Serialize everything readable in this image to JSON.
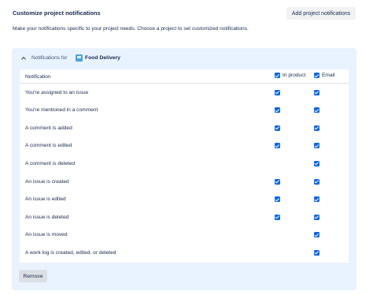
{
  "header": {
    "title": "Customize project notifications",
    "add_button_label": "Add project notifications",
    "description": "Make your notifications specific to your project needs. Choose a project to set customized notifications."
  },
  "panel": {
    "notifications_for_label": "Notifications for",
    "project_name": "Food Delivery",
    "project_icon": "project-board-icon",
    "expanded": true,
    "remove_button_label": "Remove"
  },
  "table": {
    "columns": {
      "notification": "Notification",
      "in_product": "In product",
      "email": "Email"
    },
    "header_in_product_checked": true,
    "header_email_checked": true,
    "rows": [
      {
        "label": "You're assigned to an issue",
        "in_product": true,
        "email": true
      },
      {
        "label": "You're mentioned in a comment",
        "in_product": true,
        "email": true
      },
      {
        "label": "A comment is added",
        "in_product": true,
        "email": true
      },
      {
        "label": "A comment is edited",
        "in_product": true,
        "email": true
      },
      {
        "label": "A comment is deleted",
        "in_product": false,
        "email": true
      },
      {
        "label": "An issue is created",
        "in_product": true,
        "email": true
      },
      {
        "label": "An issue is edited",
        "in_product": true,
        "email": true
      },
      {
        "label": "An issue is deleted",
        "in_product": true,
        "email": true
      },
      {
        "label": "An issue is moved",
        "in_product": false,
        "email": true
      },
      {
        "label": "A work log is created, edited, or deleted",
        "in_product": false,
        "email": true
      }
    ]
  },
  "colors": {
    "accent": "#0c66e4",
    "panel_bg": "#e9f2ff",
    "text": "#172b4d"
  }
}
